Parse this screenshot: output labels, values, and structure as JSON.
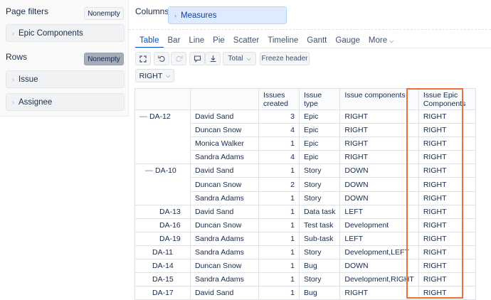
{
  "page_filters": {
    "title": "Page filters",
    "nonempty_label": "Nonempty",
    "items": [
      {
        "label": "Epic Components"
      }
    ]
  },
  "rows": {
    "title": "Rows",
    "nonempty_label": "Nonempty",
    "items": [
      {
        "label": "Issue"
      },
      {
        "label": "Assignee"
      }
    ]
  },
  "columns": {
    "title": "Columns",
    "items": [
      {
        "label": "Measures"
      }
    ]
  },
  "tabs": [
    {
      "label": "Table",
      "active": true
    },
    {
      "label": "Bar"
    },
    {
      "label": "Line"
    },
    {
      "label": "Pie"
    },
    {
      "label": "Scatter"
    },
    {
      "label": "Timeline"
    },
    {
      "label": "Gantt"
    },
    {
      "label": "Gauge"
    },
    {
      "label": "More"
    }
  ],
  "toolbar": {
    "total_label": "Total",
    "freeze_label": "Freeze header",
    "icons": [
      "expand-icon",
      "undo-icon",
      "redo-icon",
      "comment-icon",
      "download-icon"
    ]
  },
  "right_select": {
    "label": "RIGHT"
  },
  "table": {
    "headers": [
      "Issues created",
      "Issue type",
      "Issue components",
      "Issue Epic Components"
    ],
    "groups": [
      {
        "issue": "DA-12",
        "rows": [
          {
            "assignee": "David Sand",
            "created": "3",
            "type": "Epic",
            "components": "RIGHT",
            "epic": "RIGHT"
          },
          {
            "assignee": "Duncan Snow",
            "created": "4",
            "type": "Epic",
            "components": "RIGHT",
            "epic": "RIGHT"
          },
          {
            "assignee": "Monica Walker",
            "created": "1",
            "type": "Epic",
            "components": "RIGHT",
            "epic": "RIGHT"
          },
          {
            "assignee": "Sandra Adams",
            "created": "4",
            "type": "Epic",
            "components": "RIGHT",
            "epic": "RIGHT"
          }
        ]
      },
      {
        "issue": "DA-10",
        "rows": [
          {
            "assignee": "David Sand",
            "created": "1",
            "type": "Story",
            "components": "DOWN",
            "epic": "RIGHT"
          },
          {
            "assignee": "Duncan Snow",
            "created": "2",
            "type": "Story",
            "components": "DOWN",
            "epic": "RIGHT"
          },
          {
            "assignee": "Sandra Adams",
            "created": "1",
            "type": "Story",
            "components": "DOWN",
            "epic": "RIGHT"
          }
        ]
      }
    ],
    "single_rows": [
      {
        "issue": "DA-13",
        "assignee": "David Sand",
        "created": "1",
        "type": "Data task",
        "components": "LEFT",
        "epic": "RIGHT"
      },
      {
        "issue": "DA-16",
        "assignee": "Duncan Snow",
        "created": "1",
        "type": "Test task",
        "components": "Development",
        "epic": "RIGHT"
      },
      {
        "issue": "DA-19",
        "assignee": "Sandra Adams",
        "created": "1",
        "type": "Sub-task",
        "components": "LEFT",
        "epic": "RIGHT"
      },
      {
        "issue": "DA-11",
        "assignee": "Sandra Adams",
        "created": "1",
        "type": "Story",
        "components": "Development,LEFT",
        "epic": "RIGHT"
      },
      {
        "issue": "DA-14",
        "assignee": "Duncan Snow",
        "created": "1",
        "type": "Bug",
        "components": "DOWN",
        "epic": "RIGHT"
      },
      {
        "issue": "DA-15",
        "assignee": "Sandra Adams",
        "created": "1",
        "type": "Story",
        "components": "Development,RIGHT",
        "epic": "RIGHT"
      },
      {
        "issue": "DA-17",
        "assignee": "David Sand",
        "created": "1",
        "type": "Bug",
        "components": "RIGHT",
        "epic": "RIGHT"
      }
    ]
  },
  "colors": {
    "accent": "#0052cc",
    "highlight": "#e8703a"
  }
}
